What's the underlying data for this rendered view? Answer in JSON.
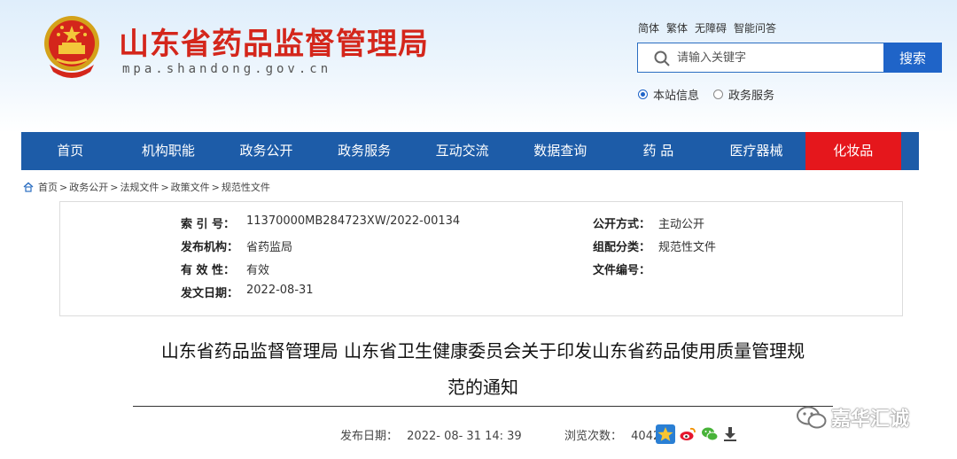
{
  "header": {
    "site_title": "山东省药品监督管理局",
    "site_domain": "mpa.shandong.gov.cn",
    "util_links": [
      "简体",
      "繁体",
      "无障碍",
      "智能问答"
    ],
    "search": {
      "placeholder": "请输入关键字",
      "button": "搜索"
    },
    "scope": {
      "site": "本站信息",
      "gov": "政务服务",
      "selected": "site"
    }
  },
  "nav": {
    "items": [
      "首页",
      "机构职能",
      "政务公开",
      "政务服务",
      "互动交流",
      "数据查询",
      "药 品",
      "医疗器械",
      "化妆品"
    ],
    "active_index": 8,
    "active_color": "#e5171c",
    "bar_color": "#1d5ca8"
  },
  "breadcrumb": [
    "首页",
    "政务公开",
    "法规文件",
    "政策文件",
    "规范性文件"
  ],
  "info": {
    "index_label": "索 引 号：",
    "index_value": "11370000MB284723XW/2022-00134",
    "publisher_label": "发布机构：",
    "publisher_value": "省药监局",
    "validity_label": "有 效 性：",
    "validity_value": "有效",
    "date_label": "发文日期：",
    "date_value": "2022-08-31",
    "open_label": "公开方式：",
    "open_value": "主动公开",
    "category_label": "组配分类：",
    "category_value": "规范性文件",
    "docno_label": "文件编号：",
    "docno_value": ""
  },
  "article": {
    "title_line1": "山东省药品监督管理局 山东省卫生健康委员会关于印发山东省药品使用质量管理规",
    "title_line2": "范的通知",
    "publish_label": "发布日期：",
    "publish_value": "2022- 08- 31 14: 39",
    "views_label": "浏览次数：",
    "views_value": "4042"
  },
  "watermark": "嘉华汇诚",
  "share_icons": [
    "qzone-icon",
    "weibo-icon",
    "wechat-icon",
    "download-icon"
  ]
}
